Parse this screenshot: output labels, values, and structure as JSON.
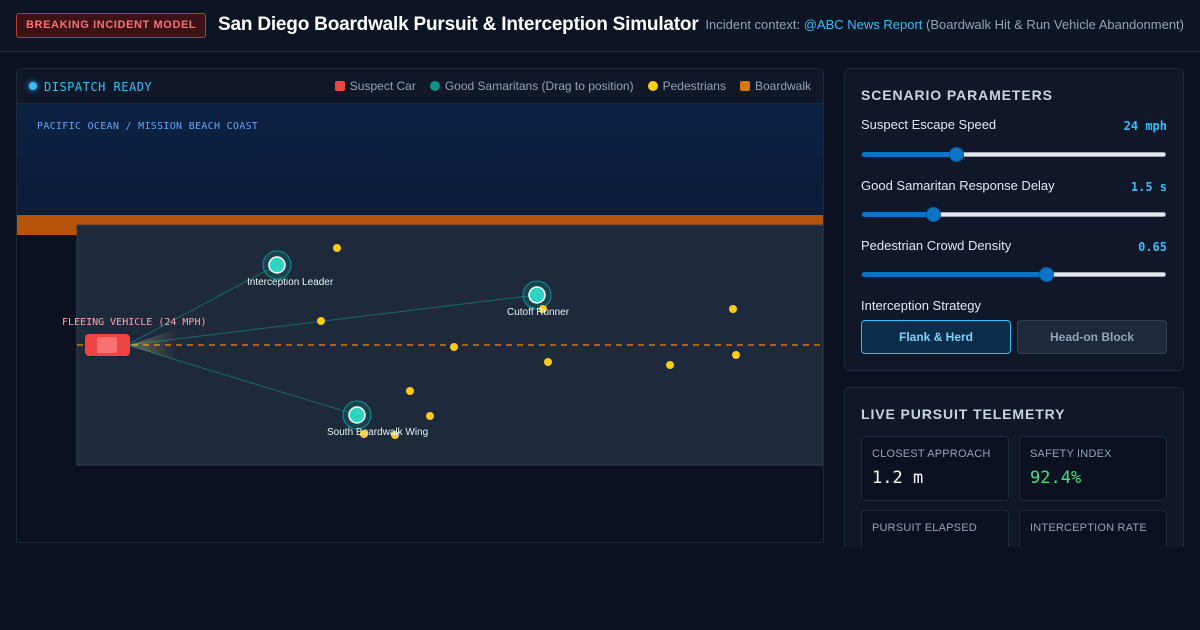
{
  "header": {
    "badge": "BREAKING INCIDENT MODEL",
    "title": "San Diego Boardwalk Pursuit & Interception Simulator",
    "context_prefix": "Incident context:",
    "context_link": "@ABC News Report",
    "context_suffix": "(Boardwalk Hit & Run Vehicle Abandonment)"
  },
  "sim": {
    "status": "DISPATCH READY",
    "legend": [
      {
        "label": "Suspect Car",
        "color": "#ef4444"
      },
      {
        "label": "Good Samaritans (Drag to position)",
        "color": "#0d9488"
      },
      {
        "label": "Pedestrians",
        "color": "#facc15"
      },
      {
        "label": "Boardwalk",
        "color": "#d97706"
      }
    ],
    "ocean_label": "PACIFIC OCEAN / MISSION BEACH COAST",
    "vehicle_label": "FLEEING VEHICLE (24 MPH)",
    "samaritans": [
      "Interception Leader",
      "Cutoff Runner",
      "South Boardwalk Wing"
    ]
  },
  "params": {
    "title": "SCENARIO PARAMETERS",
    "speed": {
      "label": "Suspect Escape Speed",
      "value": "24 mph",
      "fraction": 0.31
    },
    "delay": {
      "label": "Good Samaritan Response Delay",
      "value": "1.5 s",
      "fraction": 0.235
    },
    "density": {
      "label": "Pedestrian Crowd Density",
      "value": "0.65",
      "fraction": 0.605
    },
    "strategy_label": "Interception Strategy",
    "strategies": [
      "Flank & Herd",
      "Head-on Block"
    ],
    "selected_strategy": "Flank & Herd"
  },
  "telemetry": {
    "title": "LIVE PURSUIT TELEMETRY",
    "stats": [
      {
        "label": "CLOSEST APPROACH",
        "value": "1.2 m"
      },
      {
        "label": "SAFETY INDEX",
        "value": "92.4%"
      },
      {
        "label": "PURSUIT ELAPSED",
        "value": ""
      },
      {
        "label": "INTERCEPTION RATE",
        "value": ""
      }
    ]
  }
}
